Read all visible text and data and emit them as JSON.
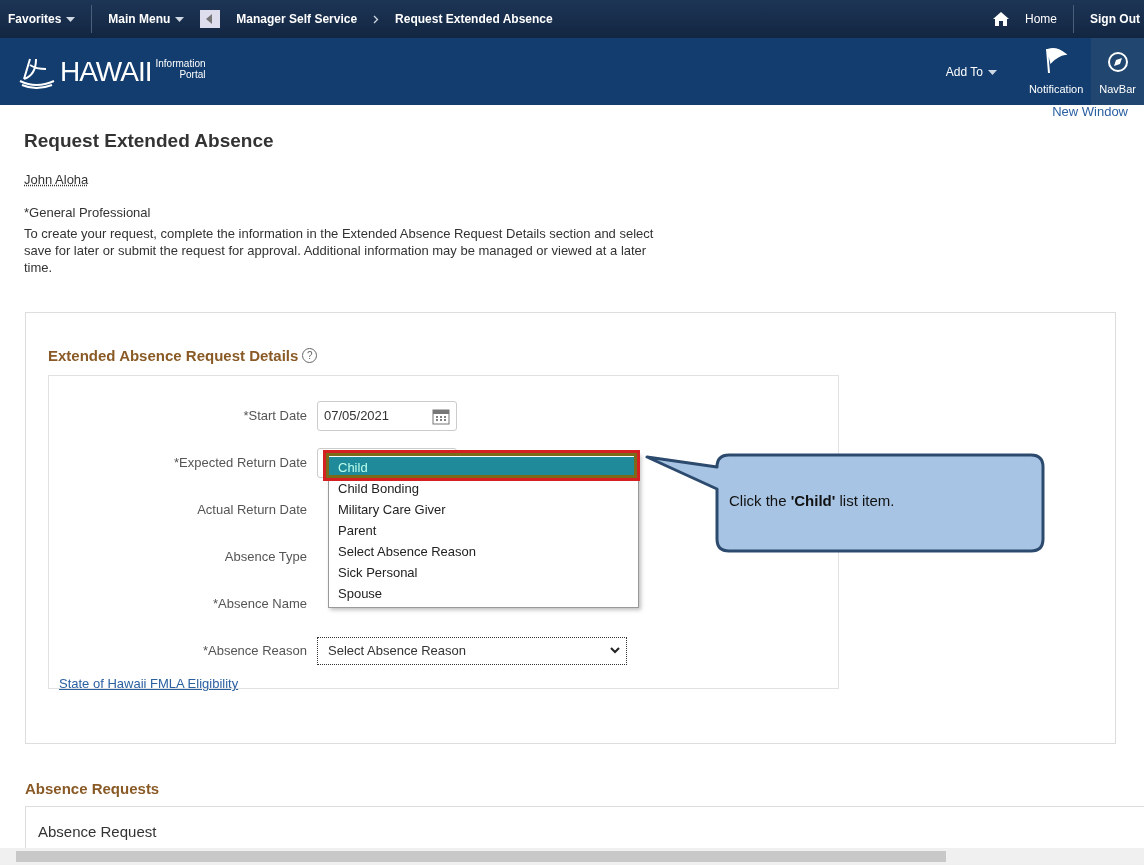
{
  "top_bar": {
    "menus": [
      {
        "label": "Favorites"
      },
      {
        "label": "Main Menu"
      }
    ],
    "breadcrumbs": [
      "Manager Self Service",
      "Request Extended Absence"
    ],
    "links": [
      "Home",
      "Sign Out"
    ]
  },
  "header": {
    "logo_text": "HAWAII",
    "logo_subtext": [
      "Information",
      "Portal"
    ],
    "add_to": "Add To",
    "buttons": [
      "Notification",
      "NavBar"
    ]
  },
  "new_window": "New Window",
  "page_title": "Request Extended Absence",
  "employee_name": "John Aloha",
  "job_title": "*General Professional",
  "instructions": "To create your request, complete the information in the Extended Absence Request Details section and select save for later or submit the request for approval. Additional information may be managed or viewed at a later time.",
  "details": {
    "title": "Extended Absence Request Details",
    "help": "?",
    "fields": [
      {
        "label": "*Start Date",
        "kind": "date",
        "value": "07/05/2021"
      },
      {
        "label": "*Expected Return Date",
        "kind": "date"
      },
      {
        "label": "Actual Return Date",
        "kind": "covered"
      },
      {
        "label": "Absence Type",
        "kind": "covered"
      },
      {
        "label": "*Absence Name",
        "kind": "covered"
      },
      {
        "label": "*Absence Reason",
        "kind": "select",
        "value": "Select Absence Reason"
      }
    ],
    "link": "State of Hawaii FMLA Eligibility"
  },
  "dropdown": {
    "options": [
      {
        "label": "Child",
        "selected": true
      },
      {
        "label": "Child Bonding",
        "selected": false
      },
      {
        "label": "Military Care Giver",
        "selected": false
      },
      {
        "label": "Parent",
        "selected": false
      },
      {
        "label": "Select Absence Reason",
        "selected": false
      },
      {
        "label": "Sick Personal",
        "selected": false
      },
      {
        "label": "Spouse",
        "selected": false
      }
    ]
  },
  "callout": {
    "text": "Click the **'Child'** list item."
  },
  "absence_requests": {
    "title": "Absence Requests",
    "subtitle": "Absence Request"
  }
}
